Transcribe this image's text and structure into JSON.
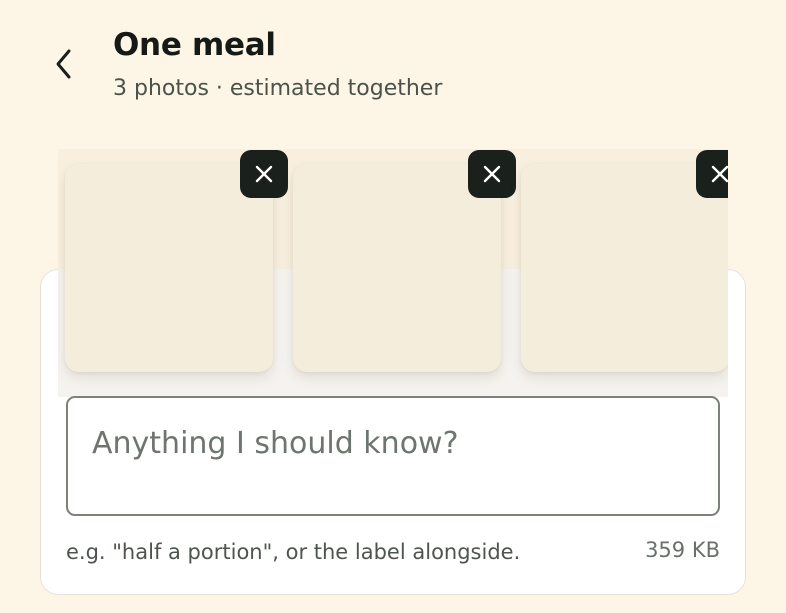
{
  "header": {
    "back_icon": "chevron-left-icon",
    "title": "One meal",
    "subtitle": "3 photos · estimated together"
  },
  "photos": [
    {
      "remove_icon": "close-icon"
    },
    {
      "remove_icon": "close-icon"
    },
    {
      "remove_icon": "close-icon"
    }
  ],
  "note": {
    "value": "",
    "placeholder": "Anything I should know?",
    "hint": "e.g. \"half a portion\", or the label alongside.",
    "size": "359 KB"
  },
  "colors": {
    "background": "#fdf6e7",
    "card": "#ffffff",
    "photo_placeholder": "#f5eddc",
    "remove_button": "#1a211c",
    "input_border": "#7a8279"
  }
}
